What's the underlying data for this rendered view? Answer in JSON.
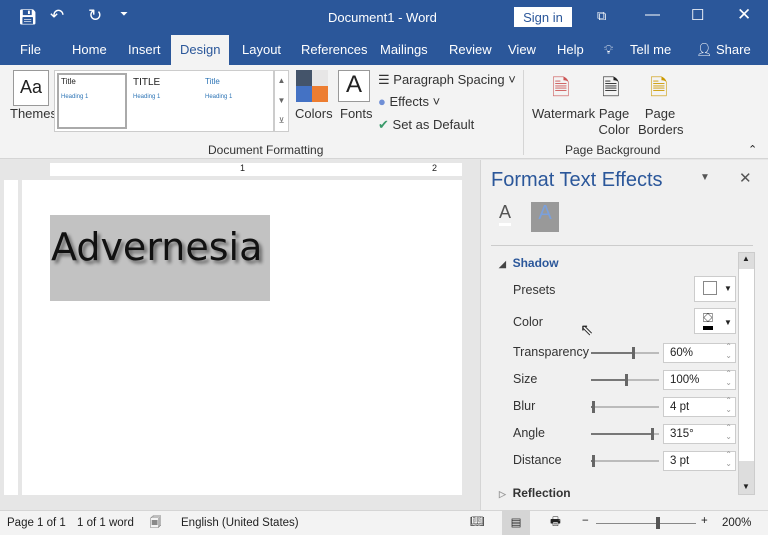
{
  "title_bar": {
    "title": "Document1  -  Word",
    "sign_in": "Sign in"
  },
  "tabs": [
    "File",
    "Home",
    "Insert",
    "Design",
    "Layout",
    "References",
    "Mailings",
    "Review",
    "View",
    "Help"
  ],
  "active_tab": "Design",
  "tell_me": "Tell me",
  "share": "Share",
  "ribbon": {
    "themes": "Themes",
    "gallery": [
      {
        "title": "Title",
        "heading": "Heading 1"
      },
      {
        "title": "TITLE",
        "heading": "Heading 1"
      },
      {
        "title": "Title",
        "heading": "Heading 1"
      }
    ],
    "colors": "Colors",
    "fonts": "Fonts",
    "paragraph_spacing": "Paragraph Spacing",
    "effects": "Effects",
    "set_default": "Set as Default",
    "group1": "Document Formatting",
    "watermark": "Watermark",
    "page_color": "Page Color",
    "page_borders": "Page Borders",
    "group2": "Page Background"
  },
  "document": {
    "text": "Advernesia"
  },
  "pane": {
    "title": "Format Text Effects",
    "section": "Shadow",
    "presets": "Presets",
    "color": "Color",
    "rows": [
      {
        "label": "Transparency",
        "value": "60%",
        "level": 0.6
      },
      {
        "label": "Size",
        "value": "100%",
        "level": 0.5
      },
      {
        "label": "Blur",
        "value": "4 pt",
        "level": 0.02
      },
      {
        "label": "Angle",
        "value": "315°",
        "level": 0.875
      },
      {
        "label": "Distance",
        "value": "3 pt",
        "level": 0.02
      }
    ],
    "next_section": "Reflection"
  },
  "status": {
    "page": "Page 1 of 1",
    "words": "1 of 1 word",
    "language": "English (United States)",
    "zoom": "200%",
    "zoom_level": 0.6
  },
  "colors": {
    "brand": "#2b579a",
    "accent": "#2e75b6"
  }
}
